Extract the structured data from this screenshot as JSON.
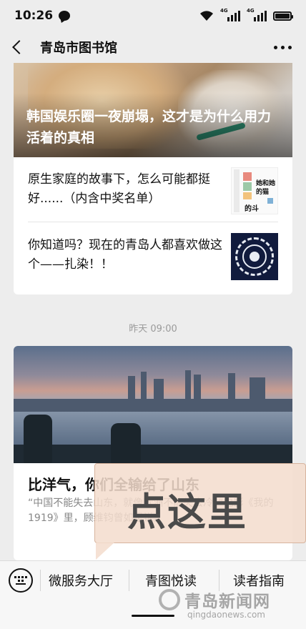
{
  "status_bar": {
    "time": "10:26",
    "net_label_1": "4G",
    "net_label_2": "4G"
  },
  "nav": {
    "title": "青岛市图书馆"
  },
  "feed": {
    "group1": {
      "hero_headline": "韩国娱乐圈一夜崩塌，这才是为什么用力活着的真相",
      "items": [
        {
          "title": "原生家庭的故事下，怎么可能都挺好......（内含中奖名单）",
          "thumb_line1": "她和她",
          "thumb_line2": "的猫",
          "thumb_line3": "的斗"
        },
        {
          "title": "你知道吗？现在的青岛人都喜欢做这个——扎染！！"
        }
      ]
    },
    "timestamp": "昨天 09:00",
    "group2": {
      "title": "比洋气，你们全输给了山东",
      "description": "“中国不能失去山东，就像欧洲不能失去冷。”电影《我的1919》里，顾维钧曾如是说。"
    }
  },
  "callout": {
    "text": "点这里"
  },
  "menu": {
    "items": [
      "微服务大厅",
      "青图悦读",
      "读者指南"
    ]
  },
  "watermark": {
    "main": "青岛新闻网",
    "sub": "qingdaonews.com"
  }
}
